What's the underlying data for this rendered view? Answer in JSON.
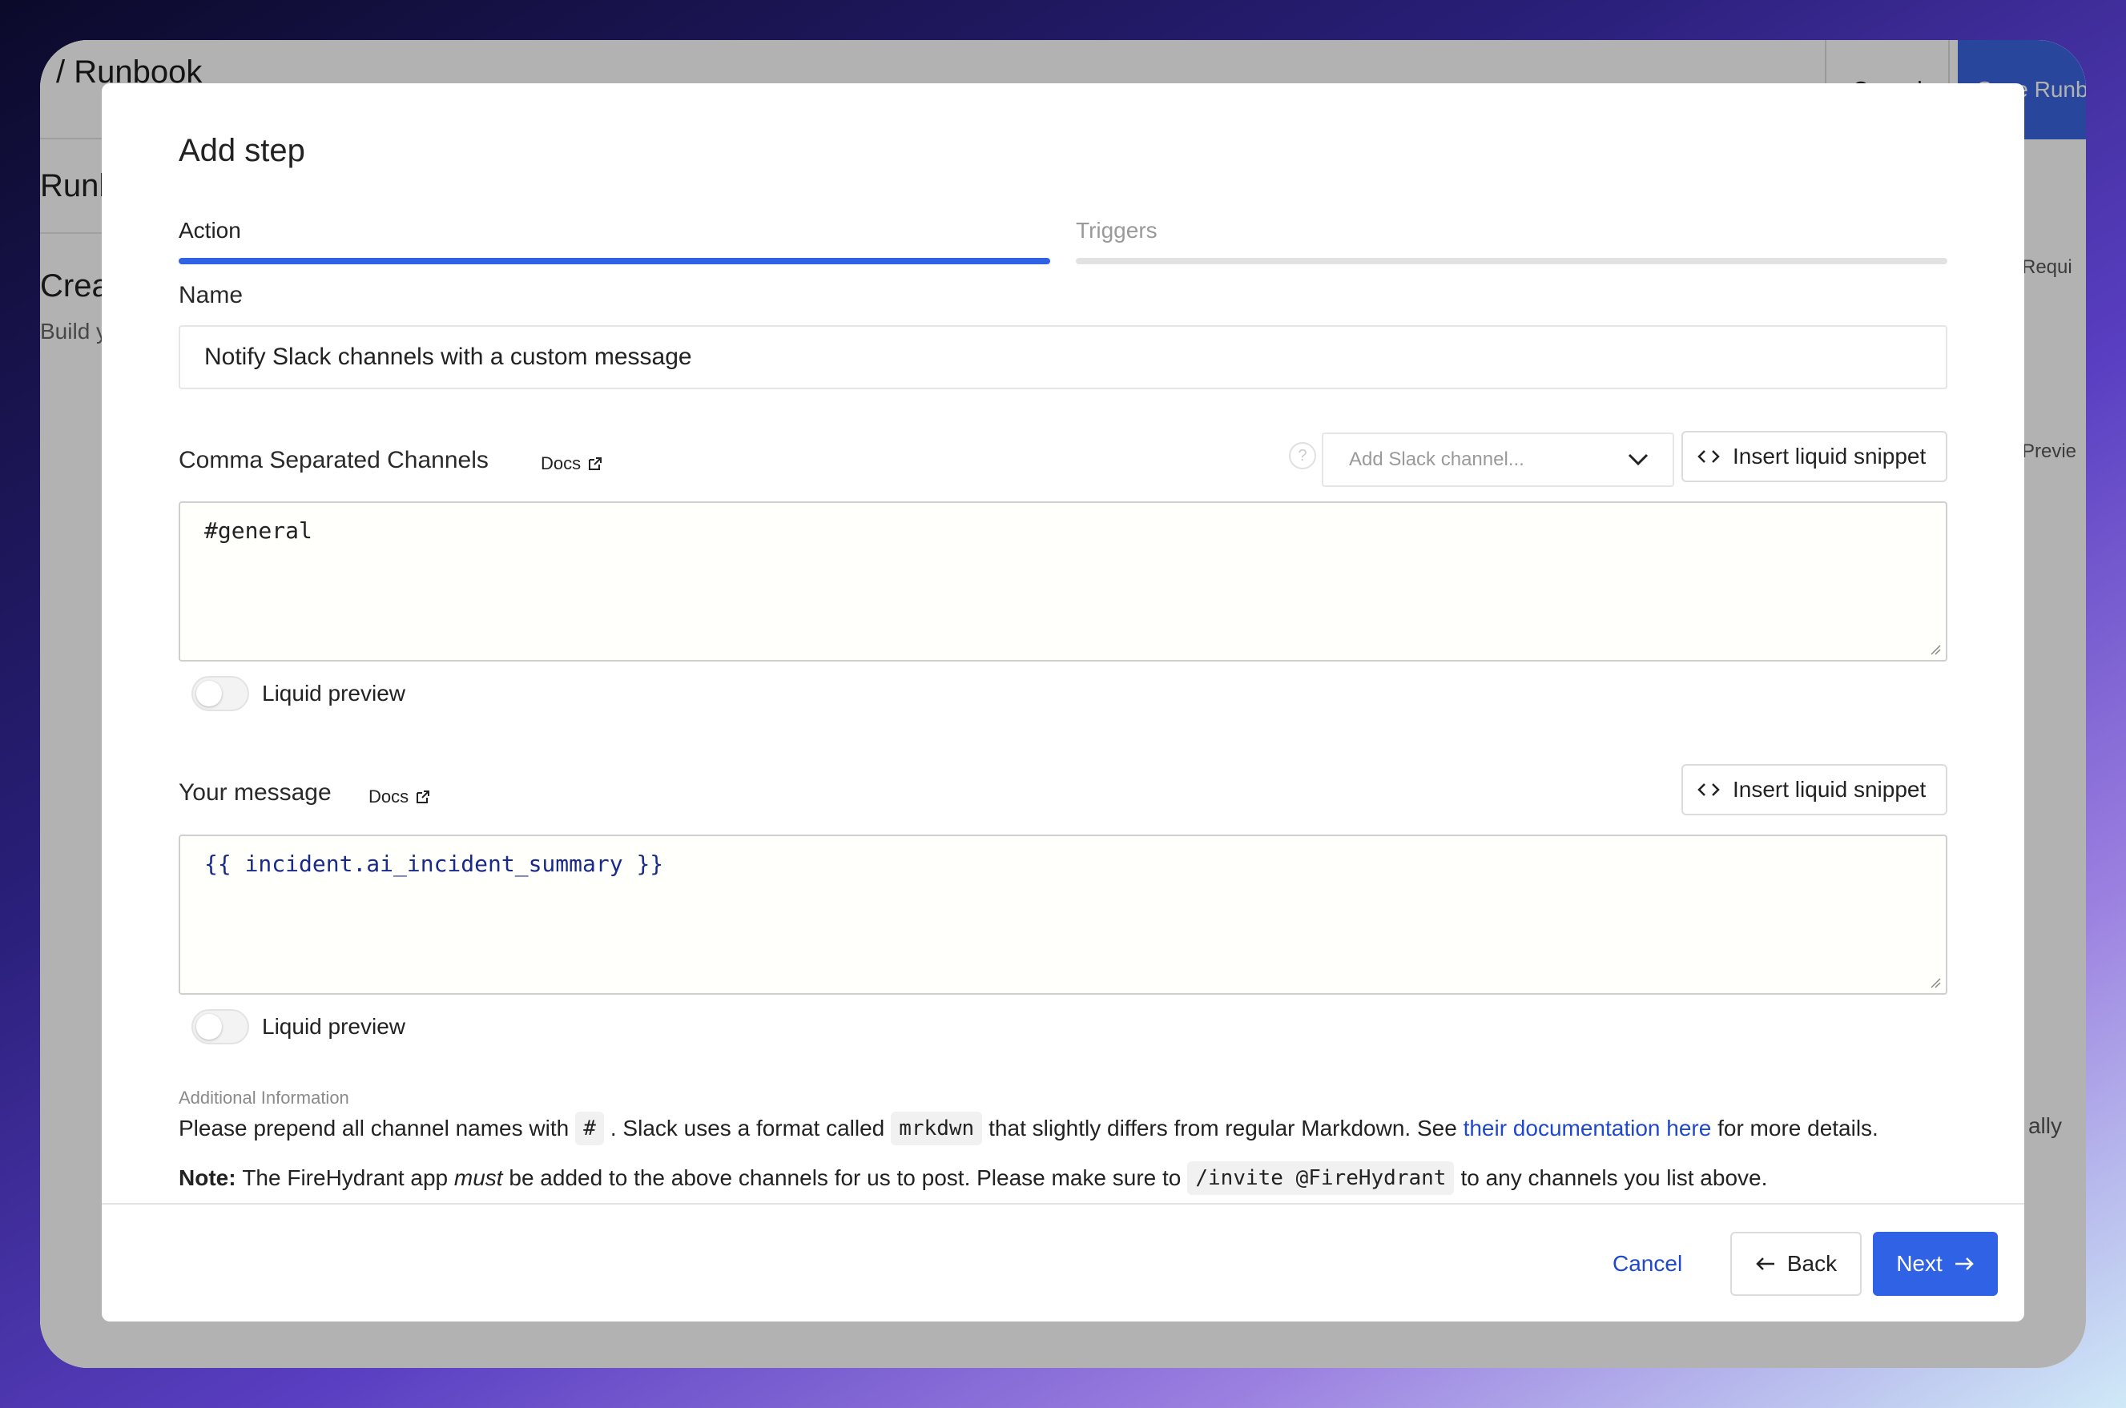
{
  "background": {
    "title": "Runbook",
    "cancel": "Cancel",
    "save": "Save Runbook",
    "subtitle1": "Runbo",
    "subtitle2": "Crea",
    "subtitle3": "Build y",
    "right1": "Requi",
    "right2": "Previe",
    "right3": "ally"
  },
  "modal": {
    "title": "Add step",
    "tabs": [
      {
        "label": "Action",
        "active": true
      },
      {
        "label": "Triggers",
        "active": false
      }
    ],
    "name": {
      "label": "Name",
      "value": "Notify Slack channels with a custom message"
    },
    "channels": {
      "label": "Comma Separated Channels",
      "docs": "Docs",
      "select_placeholder": "Add Slack channel...",
      "snippet_button": "Insert liquid snippet",
      "value": "#general",
      "toggle_label": "Liquid preview"
    },
    "message": {
      "label": "Your message",
      "docs": "Docs",
      "snippet_button": "Insert liquid snippet",
      "value": "{{ incident.ai_incident_summary }}",
      "toggle_label": "Liquid preview"
    },
    "additional": {
      "heading": "Additional Information",
      "line1_a": "Please prepend all channel names with",
      "line1_code1": "#",
      "line1_b": ". Slack uses a format called",
      "line1_code2": "mrkdwn",
      "line1_c": "that slightly differs from regular Markdown. See",
      "line1_link": "their documentation here",
      "line1_d": "for more details.",
      "note_label": "Note:",
      "line2_a": "The FireHydrant app",
      "line2_em": "must",
      "line2_b": "be added to the above channels for us to post. Please make sure to",
      "line2_code": "/invite @FireHydrant",
      "line2_c": "to any channels you list above."
    },
    "footer": {
      "cancel": "Cancel",
      "back": "Back",
      "next": "Next"
    }
  },
  "colors": {
    "accent": "#2f62e5",
    "link": "#1f49c9",
    "liquid_text": "#1a2a8c"
  }
}
